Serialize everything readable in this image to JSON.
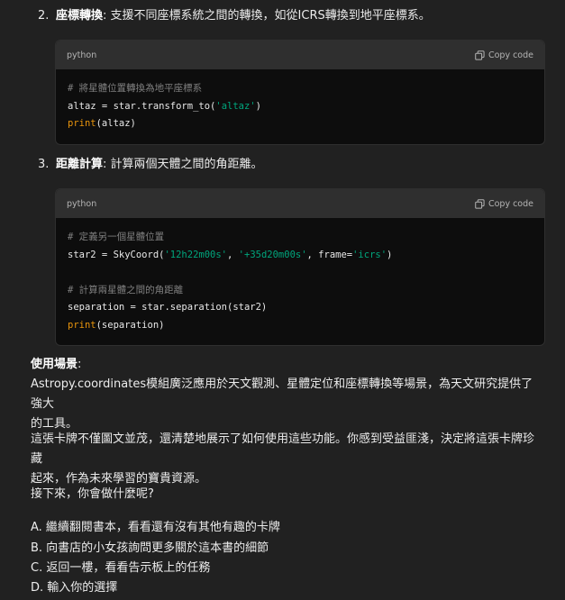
{
  "item2": {
    "num": "2.",
    "title": "座標轉換",
    "desc": ": 支援不同座標系統之間的轉換，如從ICRS轉換到地平座標系。"
  },
  "code1": {
    "lang": "python",
    "copy_label": "Copy code",
    "lines": [
      [
        {
          "t": "# 將星體位置轉換為地平座標系",
          "c": "cm"
        }
      ],
      [
        {
          "t": "altaz = star.transform_to(",
          "c": ""
        },
        {
          "t": "'altaz'",
          "c": "st"
        },
        {
          "t": ")",
          "c": ""
        }
      ],
      [
        {
          "t": "print",
          "c": "kw"
        },
        {
          "t": "(altaz)",
          "c": ""
        }
      ]
    ]
  },
  "item3": {
    "num": "3.",
    "title": "距離計算",
    "desc": ": 計算兩個天體之間的角距離。"
  },
  "code2": {
    "lang": "python",
    "copy_label": "Copy code",
    "lines": [
      [
        {
          "t": "# 定義另一個星體位置",
          "c": "cm"
        }
      ],
      [
        {
          "t": "star2 = SkyCoord(",
          "c": ""
        },
        {
          "t": "'12h22m00s'",
          "c": "st"
        },
        {
          "t": ", ",
          "c": ""
        },
        {
          "t": "'+35d20m00s'",
          "c": "st"
        },
        {
          "t": ", frame=",
          "c": ""
        },
        {
          "t": "'icrs'",
          "c": "st"
        },
        {
          "t": ")",
          "c": ""
        }
      ],
      [
        {
          "t": "",
          "c": ""
        }
      ],
      [
        {
          "t": "# 計算兩星體之間的角距離",
          "c": "cm"
        }
      ],
      [
        {
          "t": "separation = star.separation(star2)",
          "c": ""
        }
      ],
      [
        {
          "t": "print",
          "c": "kw"
        },
        {
          "t": "(separation)",
          "c": ""
        }
      ]
    ]
  },
  "usage": {
    "heading": "使用場景",
    "colon": ":",
    "line1": "Astropy.coordinates模組廣泛應用於天文觀測、星體定位和座標轉換等場景，為天文研究提供了強大",
    "line2": "的工具。"
  },
  "story": {
    "line1": "這張卡牌不僅圖文並茂，還清楚地展示了如何使用這些功能。你感到受益匪淺，決定將這張卡牌珍藏",
    "line2": "起來，作為未來學習的寶貴資源。"
  },
  "prompt": "接下來，你會做什麼呢?",
  "options": [
    "A. 繼續翻閱書本，看看還有沒有其他有趣的卡牌",
    "B. 向書店的小女孩詢問更多關於這本書的細節",
    "C. 返回一樓，看看告示板上的任務",
    "D. 輸入你的選擇"
  ]
}
